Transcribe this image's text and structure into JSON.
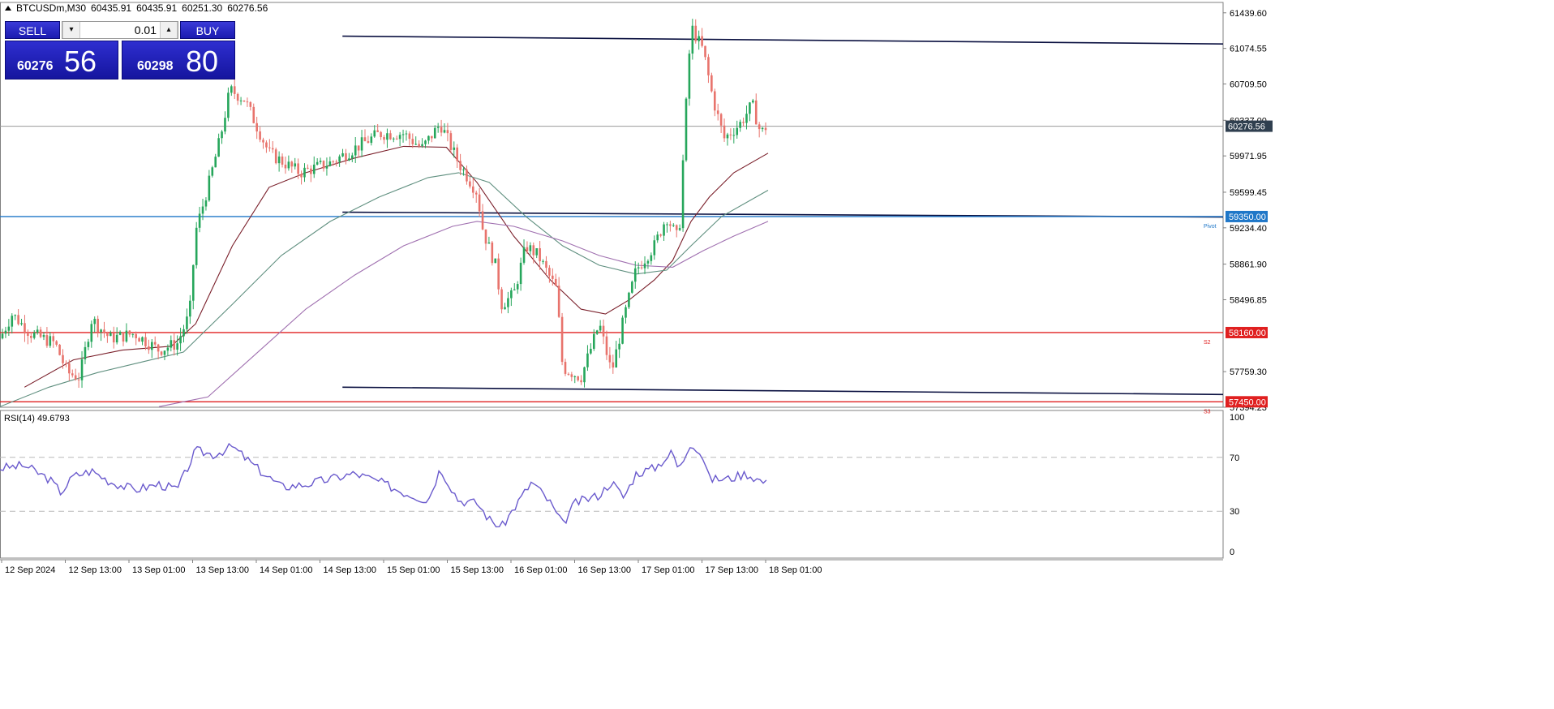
{
  "header": {
    "symbol": "BTCUSDm,M30",
    "open": "60435.91",
    "high": "60435.91",
    "low": "60251.30",
    "close": "60276.56"
  },
  "trade_panel": {
    "sell_label": "SELL",
    "buy_label": "BUY",
    "lot": "0.01",
    "lot_down": "▾",
    "lot_up": "▴",
    "sell_price_small": "60276",
    "sell_price_big": "56",
    "buy_price_small": "60298",
    "buy_price_big": "80"
  },
  "colors": {
    "bull_candle": "#26a65b",
    "bear_candle": "#e8736c",
    "pivot_line": "#1f77c8",
    "support_line": "#e02020",
    "channel_line": "#0a1040",
    "rsi_line": "#6a5acd",
    "ma_fast": "#7a1f2a",
    "ma_mid": "#5f8f7f",
    "ma_slow": "#a070b0"
  },
  "chart_data": {
    "type": "candlestick",
    "symbol": "BTCUSDm",
    "timeframe": "M30",
    "ylim": [
      57394.23,
      61546.0
    ],
    "y_tick_labels": [
      "61439.60",
      "61074.55",
      "60709.50",
      "60337.00",
      "59971.95",
      "59599.45",
      "59234.40",
      "58861.90",
      "58496.85",
      "57759.30",
      "57394.23"
    ],
    "x_tick_labels": [
      "12 Sep 2024",
      "12 Sep 13:00",
      "13 Sep 01:00",
      "13 Sep 13:00",
      "14 Sep 01:00",
      "14 Sep 13:00",
      "15 Sep 01:00",
      "15 Sep 13:00",
      "16 Sep 01:00",
      "16 Sep 13:00",
      "17 Sep 01:00",
      "17 Sep 13:00",
      "18 Sep 01:00"
    ],
    "current_price": {
      "value": 60276.56,
      "label": "60276.56"
    },
    "horizontal_levels": [
      {
        "name": "Pivot",
        "value": 59350.0,
        "label": "59350.00",
        "tag": "Pivot",
        "color": "#1f77c8"
      },
      {
        "name": "S2",
        "value": 58160.0,
        "label": "58160.00",
        "tag": "S2",
        "color": "#e02020"
      },
      {
        "name": "S3",
        "value": 57450.0,
        "label": "57450.00",
        "tag": "S3",
        "color": "#e02020"
      }
    ],
    "channel_lines": [
      {
        "x": [
          0.28,
          1.0
        ],
        "y": [
          61200,
          61120
        ]
      },
      {
        "x": [
          0.28,
          1.0
        ],
        "y": [
          59395,
          59345
        ]
      },
      {
        "x": [
          0.28,
          1.0
        ],
        "y": [
          57600,
          57525
        ]
      }
    ],
    "price_path": [
      [
        0.0,
        58100
      ],
      [
        0.01,
        58350
      ],
      [
        0.025,
        58150
      ],
      [
        0.045,
        58050
      ],
      [
        0.055,
        57750
      ],
      [
        0.065,
        57700
      ],
      [
        0.075,
        58300
      ],
      [
        0.09,
        58100
      ],
      [
        0.11,
        58150
      ],
      [
        0.13,
        57980
      ],
      [
        0.145,
        58050
      ],
      [
        0.155,
        58350
      ],
      [
        0.16,
        59200
      ],
      [
        0.17,
        59650
      ],
      [
        0.18,
        60150
      ],
      [
        0.188,
        60650
      ],
      [
        0.2,
        60550
      ],
      [
        0.22,
        60000
      ],
      [
        0.245,
        59800
      ],
      [
        0.27,
        59900
      ],
      [
        0.29,
        60050
      ],
      [
        0.31,
        60200
      ],
      [
        0.33,
        60200
      ],
      [
        0.345,
        60050
      ],
      [
        0.36,
        60300
      ],
      [
        0.375,
        59900
      ],
      [
        0.39,
        59600
      ],
      [
        0.395,
        59200
      ],
      [
        0.405,
        58850
      ],
      [
        0.41,
        58450
      ],
      [
        0.42,
        58550
      ],
      [
        0.43,
        59050
      ],
      [
        0.44,
        58950
      ],
      [
        0.455,
        58600
      ],
      [
        0.46,
        57800
      ],
      [
        0.475,
        57700
      ],
      [
        0.49,
        58250
      ],
      [
        0.5,
        57750
      ],
      [
        0.51,
        58300
      ],
      [
        0.52,
        58800
      ],
      [
        0.535,
        59050
      ],
      [
        0.545,
        59350
      ],
      [
        0.555,
        59100
      ],
      [
        0.56,
        60300
      ],
      [
        0.565,
        61300
      ],
      [
        0.575,
        61050
      ],
      [
        0.583,
        60550
      ],
      [
        0.592,
        60150
      ],
      [
        0.605,
        60300
      ],
      [
        0.615,
        60500
      ],
      [
        0.622,
        60200
      ],
      [
        0.628,
        60300
      ]
    ],
    "moving_averages": [
      {
        "name": "MA fast",
        "color": "#7a1f2a",
        "points": [
          [
            0.02,
            57600
          ],
          [
            0.06,
            57880
          ],
          [
            0.1,
            57980
          ],
          [
            0.14,
            58020
          ],
          [
            0.16,
            58250
          ],
          [
            0.19,
            59050
          ],
          [
            0.22,
            59650
          ],
          [
            0.25,
            59800
          ],
          [
            0.29,
            59950
          ],
          [
            0.33,
            60070
          ],
          [
            0.365,
            60060
          ],
          [
            0.39,
            59700
          ],
          [
            0.42,
            59150
          ],
          [
            0.45,
            58700
          ],
          [
            0.475,
            58400
          ],
          [
            0.495,
            58350
          ],
          [
            0.515,
            58500
          ],
          [
            0.535,
            58700
          ],
          [
            0.55,
            58900
          ],
          [
            0.565,
            59300
          ],
          [
            0.58,
            59550
          ],
          [
            0.6,
            59800
          ],
          [
            0.628,
            60000
          ]
        ]
      },
      {
        "name": "MA mid",
        "color": "#5f8f7f",
        "points": [
          [
            0.0,
            57400
          ],
          [
            0.04,
            57600
          ],
          [
            0.08,
            57750
          ],
          [
            0.12,
            57870
          ],
          [
            0.15,
            57960
          ],
          [
            0.19,
            58450
          ],
          [
            0.23,
            58950
          ],
          [
            0.27,
            59300
          ],
          [
            0.31,
            59550
          ],
          [
            0.35,
            59750
          ],
          [
            0.375,
            59800
          ],
          [
            0.4,
            59700
          ],
          [
            0.43,
            59350
          ],
          [
            0.46,
            59050
          ],
          [
            0.49,
            58850
          ],
          [
            0.52,
            58760
          ],
          [
            0.545,
            58800
          ],
          [
            0.565,
            59050
          ],
          [
            0.59,
            59350
          ],
          [
            0.628,
            59620
          ]
        ]
      },
      {
        "name": "MA slow",
        "color": "#a070b0",
        "points": [
          [
            0.13,
            57400
          ],
          [
            0.17,
            57500
          ],
          [
            0.21,
            57950
          ],
          [
            0.25,
            58400
          ],
          [
            0.29,
            58750
          ],
          [
            0.33,
            59050
          ],
          [
            0.37,
            59250
          ],
          [
            0.39,
            59300
          ],
          [
            0.42,
            59250
          ],
          [
            0.46,
            59100
          ],
          [
            0.49,
            58950
          ],
          [
            0.52,
            58850
          ],
          [
            0.55,
            58830
          ],
          [
            0.575,
            59000
          ],
          [
            0.6,
            59150
          ],
          [
            0.628,
            59300
          ]
        ]
      }
    ],
    "rsi": {
      "label": "RSI(14) 49.6793",
      "period": 14,
      "value": 49.6793,
      "ylim": [
        0,
        100
      ],
      "y_tick_labels": [
        "100",
        "70",
        "30",
        "0"
      ],
      "levels": [
        70,
        30
      ],
      "points": [
        [
          0.0,
          62
        ],
        [
          0.02,
          64
        ],
        [
          0.04,
          54
        ],
        [
          0.05,
          44
        ],
        [
          0.06,
          56
        ],
        [
          0.075,
          60
        ],
        [
          0.09,
          52
        ],
        [
          0.11,
          46
        ],
        [
          0.13,
          50
        ],
        [
          0.145,
          46
        ],
        [
          0.16,
          75
        ],
        [
          0.175,
          72
        ],
        [
          0.19,
          78
        ],
        [
          0.21,
          62
        ],
        [
          0.23,
          48
        ],
        [
          0.25,
          50
        ],
        [
          0.27,
          54
        ],
        [
          0.29,
          58
        ],
        [
          0.31,
          52
        ],
        [
          0.33,
          44
        ],
        [
          0.35,
          38
        ],
        [
          0.36,
          62
        ],
        [
          0.375,
          38
        ],
        [
          0.39,
          36
        ],
        [
          0.4,
          24
        ],
        [
          0.41,
          18
        ],
        [
          0.42,
          32
        ],
        [
          0.435,
          52
        ],
        [
          0.45,
          36
        ],
        [
          0.46,
          20
        ],
        [
          0.47,
          36
        ],
        [
          0.49,
          42
        ],
        [
          0.5,
          52
        ],
        [
          0.51,
          40
        ],
        [
          0.52,
          58
        ],
        [
          0.535,
          62
        ],
        [
          0.55,
          74
        ],
        [
          0.555,
          60
        ],
        [
          0.565,
          82
        ],
        [
          0.575,
          70
        ],
        [
          0.58,
          54
        ],
        [
          0.595,
          54
        ],
        [
          0.61,
          58
        ],
        [
          0.628,
          50
        ]
      ]
    }
  }
}
